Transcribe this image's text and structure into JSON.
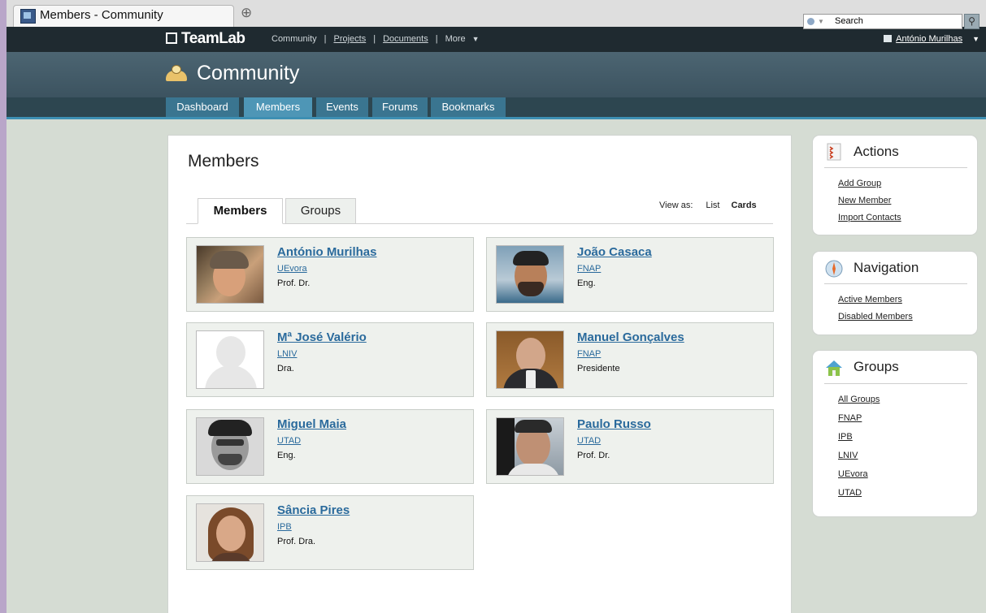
{
  "browser": {
    "tab_title": "Members - Community",
    "new_tab": "⊕"
  },
  "topbar": {
    "logo": "TeamLab",
    "nav": [
      "Community",
      "Projects",
      "Documents",
      "More"
    ],
    "separator": "|",
    "user": "António Murilhas"
  },
  "header": {
    "title": "Community",
    "search_placeholder": "Search",
    "search_button": "🔍"
  },
  "nav_tabs": [
    "Dashboard",
    "Members",
    "Events",
    "Forums",
    "Bookmarks"
  ],
  "main": {
    "title": "Members",
    "tabs": [
      "Members",
      "Groups"
    ],
    "view_as": {
      "label": "View as:",
      "list": "List",
      "cards": "Cards"
    },
    "members": [
      {
        "name": "António Murilhas",
        "org": "UEvora",
        "title": "Prof. Dr."
      },
      {
        "name": "João Casaca",
        "org": "FNAP",
        "title": "Eng."
      },
      {
        "name": "Mª José Valério",
        "org": "LNIV",
        "title": "Dra."
      },
      {
        "name": "Manuel Gonçalves",
        "org": "FNAP",
        "title": "Presidente"
      },
      {
        "name": "Miguel Maia",
        "org": "UTAD",
        "title": "Eng."
      },
      {
        "name": "Paulo Russo",
        "org": "UTAD",
        "title": "Prof. Dr."
      },
      {
        "name": "Sância Pires",
        "org": "IPB",
        "title": "Prof. Dra."
      }
    ]
  },
  "sidebar": {
    "actions": {
      "title": "Actions",
      "links": [
        "Add Group",
        "New Member",
        "Import Contacts"
      ]
    },
    "navigation": {
      "title": "Navigation",
      "links": [
        "Active Members",
        "Disabled Members"
      ]
    },
    "groups": {
      "title": "Groups",
      "links": [
        "All Groups",
        "FNAP",
        "IPB",
        "LNIV",
        "UEvora",
        "UTAD"
      ]
    }
  },
  "colors": {
    "link": "#2a6a9c",
    "nav_active": "#4e96b6",
    "nav_tab": "#3a7590",
    "header": "#4c6572"
  }
}
